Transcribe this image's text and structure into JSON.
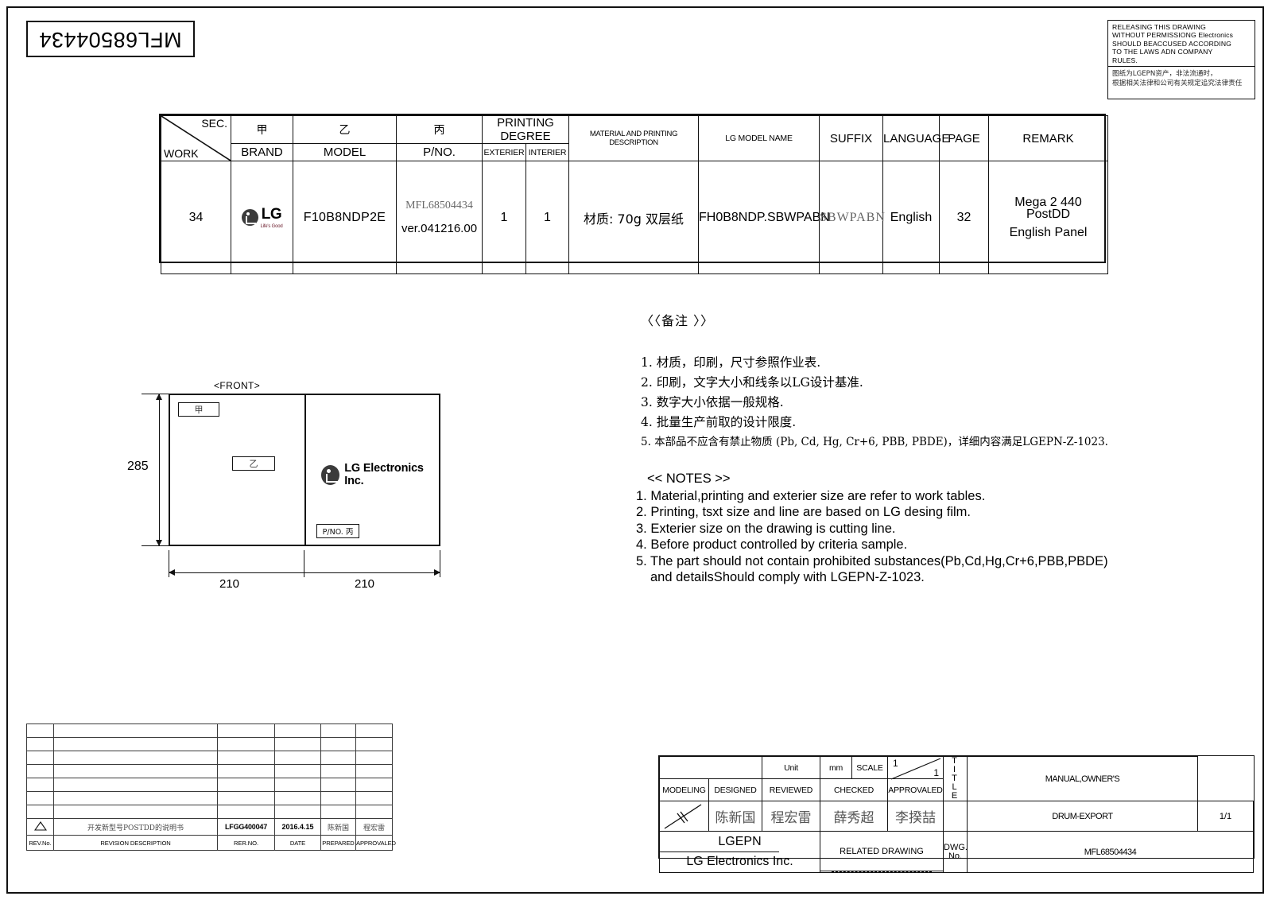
{
  "document": {
    "drawing_code_rotated": "MFL68504434",
    "disclaimer_en": [
      "RELEASING THIS DRAWING",
      "WITHOUT PERMISSIONG Electronics",
      "SHOULD BEACCUSED ACCORDING",
      "TO THE LAWS ADN COMPANY",
      "RULES."
    ],
    "disclaimer_cn": [
      "图纸为LGEPN资产，非法流通时，",
      "根据相关法律和公司有关规定追究法律责任"
    ]
  },
  "spec_table": {
    "headers_top": [
      "SEC.",
      "甲",
      "乙",
      "丙",
      "PRINTING DEGREE",
      "MATERIAL AND PRINTING DESCRIPTION",
      "LG MODEL NAME",
      "SUFFIX",
      "LANGUAGE",
      "PAGE",
      "REMARK"
    ],
    "corner_sec": "SEC.",
    "corner_work": "WORK",
    "headers_bottom": [
      "BRAND",
      "MODEL",
      "P/NO.",
      "EXTERIER",
      "INTERIER"
    ],
    "row": {
      "work": "34",
      "brand": "LG",
      "brand_slogan": "Life's Good",
      "model": "F10B8NDP2E",
      "pno_1": "MFL68504434",
      "pno_2": "ver.041216.00",
      "exterier": "1",
      "interier": "1",
      "material": "材质: 70g 双层纸",
      "lg_model_name": "FH0B8NDP.SBWPABN",
      "suffix": "SBWPABN",
      "language": "English",
      "page": "32",
      "remark_1": "Mega 2  440",
      "remark_2": "PostDD",
      "remark_3": "English Panel"
    }
  },
  "remarks_cn": {
    "title": "〈〈备注 〉〉",
    "items": [
      "1.  材质，印刷，尺寸参照作业表.",
      "2.  印刷，文字大小和线条以LG设计基准.",
      "3.  数字大小依据一般规格.",
      "4.  批量生产前取的设计限度.",
      "5.  本部品不应含有禁止物质 (Pb, Cd, Hg, Cr+6, PBB, PBDE)，详细内容满足LGEPN-Z-1023."
    ]
  },
  "notes_en": {
    "title": "<< NOTES >>",
    "items": [
      "1. Material,printing and exterier size are refer to work tables.",
      "2. Printing, tsxt  size and line are based on LG desing film.",
      "3. Exterier size on the drawing is cutting line.",
      "4. Before product controlled by criteria sample.",
      "5. The part should not contain prohibited substances(Pb,Cd,Hg,Cr+6,PBB,PBDE)",
      "and detailsShould comply with LGEPN-Z-1023."
    ]
  },
  "drawing": {
    "view_label": "<FRONT>",
    "tag_jia": "甲",
    "tag_yi": "乙",
    "tag_pno": "P/NO. 丙",
    "lg_text": "LG Electronics Inc.",
    "dim_height": "285",
    "dim_width_left": "210",
    "dim_width_right": "210"
  },
  "revision_table": {
    "labels": [
      "REV.No.",
      "REVISION DESCRIPTION",
      "RER.NO.",
      "DATE",
      "PREPARED",
      "APPROVALED"
    ],
    "empty_rows": 7,
    "entry": {
      "rev_no_icon": "warning-triangle",
      "description": "开发新型号POSTDD的说明书",
      "rer_no": "LFGG400047",
      "date": "2016.4.15",
      "prepared": "陈新国",
      "approvaled": "程宏雷"
    }
  },
  "title_block": {
    "unit_label": "Unit",
    "unit_value": "mm",
    "scale_label": "SCALE",
    "scale_num": "1",
    "scale_den": "1",
    "col_labels": [
      "MODELING",
      "DESIGNED",
      "REVIEWED",
      "CHECKED",
      "APPROVALED"
    ],
    "signatures": [
      "",
      "陈新国",
      "程宏雷",
      "薛秀超",
      "李揆喆"
    ],
    "title_side_label": "TITLE",
    "title_line1": "MANUAL,OWNER'S",
    "title_line2": "DRUM-EXPORT",
    "page_of": "1/1",
    "company_short": "LGEPN",
    "company_full": "LG Electronics Inc.",
    "related_drawing_label": "RELATED DRAWING",
    "related_drawing_value": "",
    "dwg_no_label_1": "DWG.",
    "dwg_no_label_2": "No.",
    "dwg_no_value": "MFL68504434"
  }
}
